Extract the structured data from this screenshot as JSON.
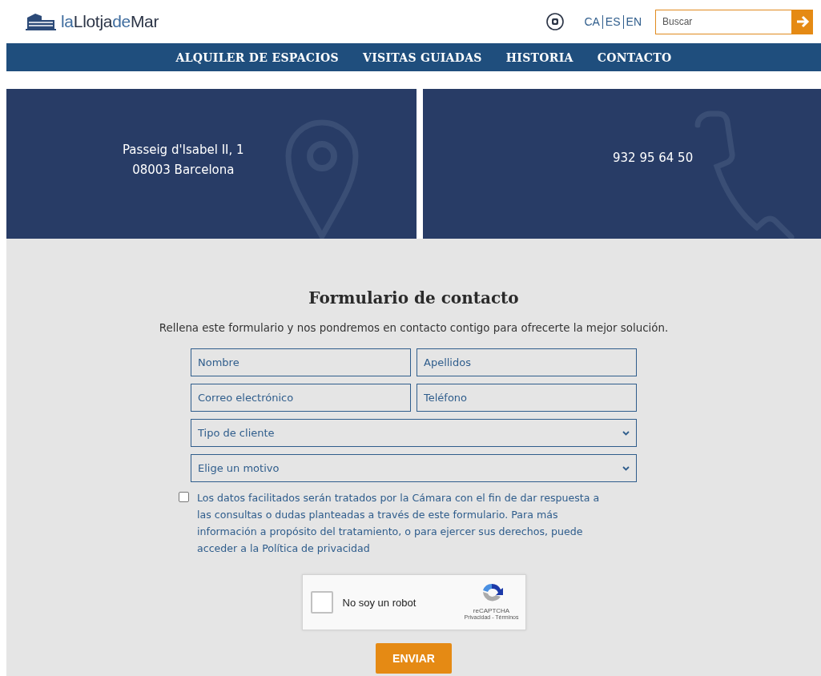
{
  "header": {
    "logo": "la**Llotja**de**Mar**",
    "languages": [
      {
        "label": "CA",
        "selected": false
      },
      {
        "label": "ES",
        "selected": false
      },
      {
        "label": "EN",
        "selected": false
      }
    ],
    "search": {
      "placeholder": "Buscar"
    }
  },
  "nav": [
    {
      "label": "ALQUILER DE ESPACIOS"
    },
    {
      "label": "VISITAS GUIADAS"
    },
    {
      "label": "HISTORIA"
    },
    {
      "label": "CONTACTO"
    }
  ],
  "contact_cards": [
    {
      "kind": "address",
      "lines": [
        "Passeig d'Isabel II, 1",
        "08003 Barcelona"
      ]
    },
    {
      "kind": "phone",
      "lines": [
        "932 95 64 50"
      ]
    }
  ],
  "form": {
    "title": "Formulario de contacto",
    "intro": "Rellena este formulario y nos pondremos en contacto contigo para ofrecerte la mejor solución.",
    "fields": [
      {
        "kind": "input",
        "placeholder": "Nombre"
      },
      {
        "kind": "input",
        "placeholder": "Apellidos"
      },
      {
        "kind": "input",
        "placeholder": "Correo electrónico"
      },
      {
        "kind": "input",
        "placeholder": "Teléfono"
      },
      {
        "kind": "select",
        "placeholder": "Tipo de cliente"
      },
      {
        "kind": "select",
        "placeholder": "Elige un motivo"
      }
    ],
    "consent": {
      "checked": false,
      "text": "Los datos facilitados serán tratados por la Cámara con el fin de dar respuesta a las consultas o dudas planteadas a través de este formulario. Para más información a propósito del tratamiento, o para ejercer sus derechos, puede acceder a la Política de privacidad"
    },
    "captcha": {
      "checked": false,
      "label": "No soy un robot",
      "brand": "reCAPTCHA",
      "links": "Privacidad - Términos"
    },
    "submit": "ENVIAR"
  }
}
